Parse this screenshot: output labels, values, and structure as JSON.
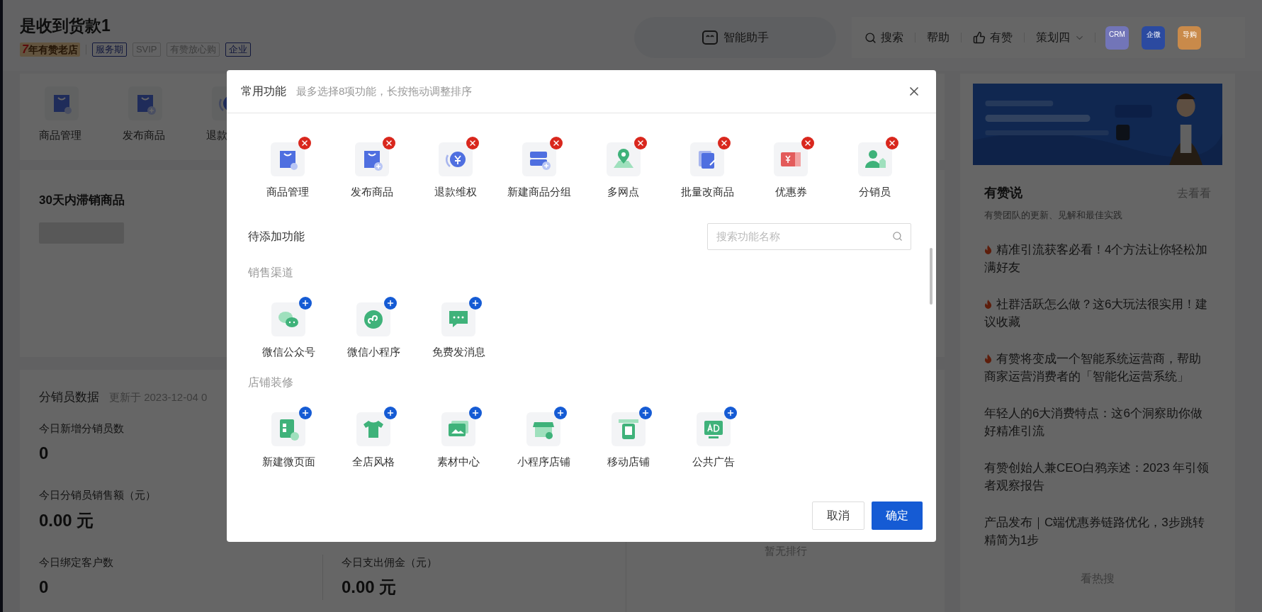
{
  "header": {
    "shop_name": "是收到货款1",
    "badges": [
      {
        "kind": "years",
        "years": "7",
        "text": "年有赞老店"
      },
      {
        "kind": "outline",
        "text": "服务期"
      },
      {
        "kind": "muted",
        "text": "SVIP"
      },
      {
        "kind": "muted",
        "text": "有赞放心购"
      },
      {
        "kind": "outline",
        "text": "企业"
      }
    ]
  },
  "assistant": {
    "label": "智能助手"
  },
  "toolbar": {
    "items": [
      {
        "kind": "search",
        "label": "搜索"
      },
      {
        "kind": "plain",
        "label": "帮助"
      },
      {
        "kind": "like",
        "label": "有赞"
      },
      {
        "kind": "dropdown",
        "label": "策划四"
      }
    ],
    "apps": [
      {
        "label": "CRM",
        "color": "#7275b8"
      },
      {
        "label": "企微",
        "color": "#2b4aa0"
      },
      {
        "label": "导购",
        "color": "#c98a4a"
      }
    ]
  },
  "quick_nav": [
    {
      "label": "商品管理"
    },
    {
      "label": "发布商品"
    },
    {
      "label": "退款"
    }
  ],
  "slow_goods": {
    "title": "30天内滞销商品"
  },
  "distributor": {
    "title": "分销员数据",
    "updated": "更新于 2023-12-04 0",
    "metrics": [
      {
        "label": "今日新增分销员数",
        "value": "0"
      },
      {
        "label": "今日分销员销售额（元）",
        "value": "0.00 元"
      },
      {
        "label": "今日绑定客户数",
        "value": "0"
      },
      {
        "label": "今日支出佣金（元）",
        "value": "0.00 元"
      }
    ],
    "ranking_empty": "暂无排行"
  },
  "news": {
    "title": "有赞说",
    "more": "去看看",
    "subtitle": "有赞团队的更新、见解和最佳实践",
    "items": [
      {
        "text": "精准引流获客必看！4个方法让你轻松加满好友",
        "hot": true
      },
      {
        "text": "社群活跃怎么做？这6大玩法很实用！建议收藏",
        "hot": true
      },
      {
        "text": "有赞将变成一个智能系统运营商，帮助商家运营消费者的「智能化运营系统」",
        "hot": true
      },
      {
        "text": "年轻人的6大消费特点：这6个洞察助你做好精准引流",
        "hot": false
      },
      {
        "text": "有赞创始人兼CEO白鸦亲述：2023 年引领者观察报告",
        "hot": false
      },
      {
        "text": "产品发布｜C端优惠券链路优化，3步跳转精简为1步",
        "hot": false
      }
    ],
    "footer": "看热搜"
  },
  "modal": {
    "title": "常用功能",
    "hint": "最多选择8项功能，长按拖动调整排序",
    "selected": [
      {
        "label": "商品管理"
      },
      {
        "label": "发布商品"
      },
      {
        "label": "退款维权"
      },
      {
        "label": "新建商品分组"
      },
      {
        "label": "多网点"
      },
      {
        "label": "批量改商品"
      },
      {
        "label": "优惠券"
      },
      {
        "label": "分销员"
      }
    ],
    "available_title": "待添加功能",
    "search": {
      "placeholder": "搜索功能名称"
    },
    "groups": [
      {
        "name": "销售渠道",
        "items": [
          {
            "label": "微信公众号"
          },
          {
            "label": "微信小程序"
          },
          {
            "label": "免费发消息"
          }
        ]
      },
      {
        "name": "店铺装修",
        "items": [
          {
            "label": "新建微页面"
          },
          {
            "label": "全店风格"
          },
          {
            "label": "素材中心"
          },
          {
            "label": "小程序店铺"
          },
          {
            "label": "移动店铺"
          },
          {
            "label": "公共广告"
          }
        ]
      }
    ],
    "buttons": [
      {
        "kind": "secondary",
        "label": "取消"
      },
      {
        "kind": "primary",
        "label": "确定"
      }
    ]
  }
}
